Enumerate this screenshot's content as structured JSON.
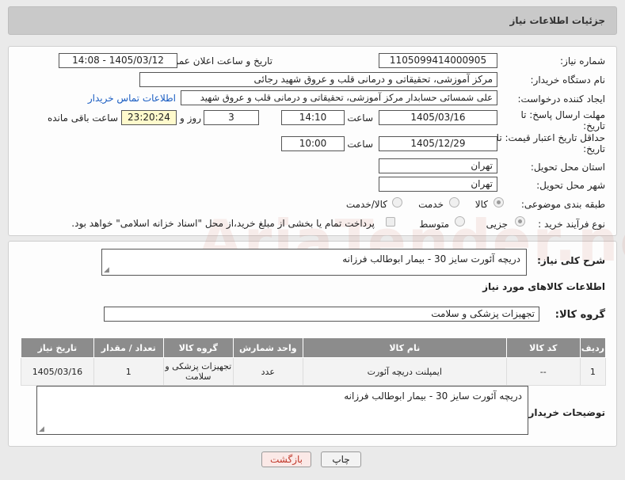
{
  "header": {
    "title": "جزئیات اطلاعات نیاز"
  },
  "watermark": "AriaTender.net",
  "form": {
    "need_number": {
      "label": "شماره نیاز:",
      "value": "1105099414000905"
    },
    "announce_datetime": {
      "label": "تاریخ و ساعت اعلان عمومی:",
      "value": "1405/03/12 - 14:08"
    },
    "buyer_org": {
      "label": "نام دستگاه خریدار:",
      "value": "مرکز آموزشی، تحقیقاتی و درمانی قلب و عروق شهید رجائی"
    },
    "requester": {
      "label": "ایجاد کننده درخواست:",
      "value": "علی شمسائی حسابدار مرکز آموزشی، تحقیقاتی و درمانی قلب و عروق شهید",
      "contact_link": "اطلاعات تماس خریدار"
    },
    "deadline": {
      "label": "مهلت ارسال پاسخ: تا تاریخ:",
      "date": "1405/03/16",
      "time_label": "ساعت",
      "time": "14:10",
      "days": "3",
      "days_label": "روز و",
      "remaining": "23:20:24",
      "remaining_label": "ساعت باقی مانده"
    },
    "price_validity": {
      "label": "حداقل تاریخ اعتبار قیمت: تا تاریخ:",
      "date": "1405/12/29",
      "time_label": "ساعت",
      "time": "10:00"
    },
    "province": {
      "label": "استان محل تحویل:",
      "value": "تهران"
    },
    "city": {
      "label": "شهر محل تحویل:",
      "value": "تهران"
    },
    "category": {
      "label": "طبقه بندی موضوعی:",
      "options": [
        "کالا",
        "خدمت",
        "کالا/خدمت"
      ],
      "selected": "کالا"
    },
    "purchase_type": {
      "label": "نوع فرآیند خرید :",
      "options": [
        "جزیی",
        "متوسط"
      ],
      "payment_note": "پرداخت تمام یا بخشی از مبلغ خرید،از محل \"اسناد خزانه اسلامی\" خواهد بود."
    }
  },
  "summary": {
    "label": "شرح کلی نیاز:",
    "value": "دریچه آئورت سایز 30 - بیمار ابوطالب فرزانه"
  },
  "goods_section": {
    "title": "اطلاعات کالاهای مورد نیاز",
    "group_label": "گروه کالا:",
    "group_value": "تجهیزات پزشکی و سلامت",
    "columns": [
      "ردیف",
      "کد کالا",
      "نام کالا",
      "واحد شمارش",
      "گروه کالا",
      "تعداد / مقدار",
      "تاریخ نیاز"
    ],
    "rows": [
      [
        "1",
        "--",
        "ایمپلنت دریچه آئورت",
        "عدد",
        "تجهیزات پزشکی و سلامت",
        "1",
        "1405/03/16"
      ]
    ]
  },
  "buyer_notes": {
    "label": "توضیحات خریدار:",
    "value": "دریچه آئورت سایز 30 - بیمار ابوطالب فرزانه"
  },
  "buttons": {
    "print": "چاپ",
    "back": "بازگشت"
  },
  "colors": {
    "back_button_text": "#c0392b",
    "link": "#1a5dc2",
    "table_header": "#8c8c8c"
  }
}
